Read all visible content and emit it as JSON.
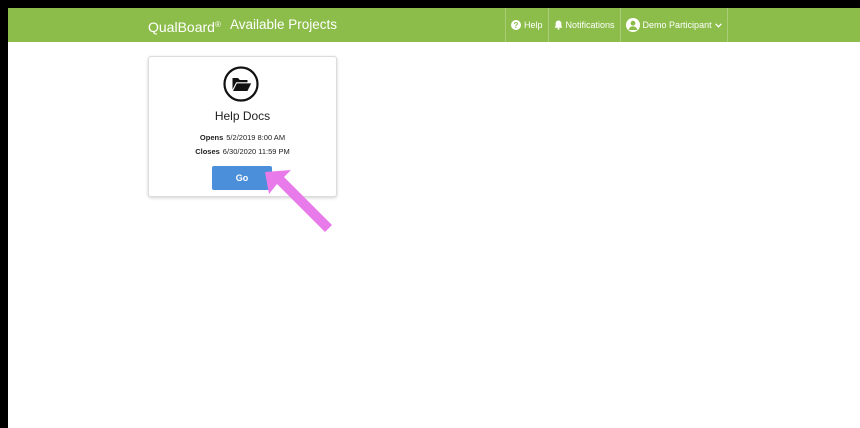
{
  "navbar": {
    "brand": "QualBoard",
    "brand_mark": "®",
    "title": "Available Projects",
    "help_label": "Help",
    "notifications_label": "Notifications",
    "user_label": "Demo Participant",
    "color": "#8cbd4a"
  },
  "project": {
    "name": "Help Docs",
    "icon": "folder-open-icon",
    "opens_label": "Opens",
    "opens_value": "5/2/2019 8:00 AM",
    "closes_label": "Closes",
    "closes_value": "6/30/2020 11:59 PM",
    "go_label": "Go",
    "button_color": "#4b8fdb"
  },
  "annotation": {
    "icon": "pointer-arrow-icon",
    "color": "#e87be9"
  }
}
